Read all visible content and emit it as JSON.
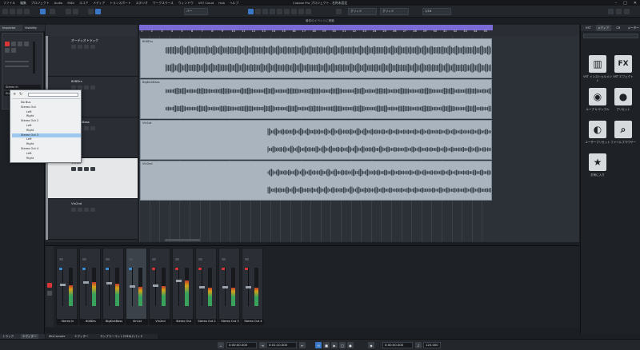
{
  "app": {
    "window_title": "Cubase Pro プロジェクト - 名称未設定",
    "menu": [
      "ファイル",
      "編集",
      "プロジェクト",
      "Audio",
      "MIDI",
      "スコア",
      "メディア",
      "トランスポート",
      "スタジオ",
      "ワークスペース",
      "ウィンドウ",
      "VST Cloud",
      "Hub",
      "ヘルプ"
    ],
    "window_controls": [
      "–",
      "□",
      "✕"
    ]
  },
  "toolbar": {
    "grid_label": "グリッド",
    "snap_label": "バー",
    "quantize_label": "1/16",
    "grid_type": "グリッド",
    "info_line": "最初のイベントに移動"
  },
  "inspector": {
    "tabs": [
      "Inspector",
      "Visibility"
    ],
    "io_labels": [
      "Stereo In",
      "Stereo Out"
    ],
    "bottom_tabs": [
      "トラック",
      "エディター"
    ]
  },
  "tracks": [
    {
      "name": "オーディオトラック",
      "color": "#8a8f96"
    },
    {
      "name": "808Drs",
      "color": "#8a8f96"
    },
    {
      "name": "BigKickBass",
      "color": "#8a8f96"
    },
    {
      "name": "Vln1st",
      "color": "#8a8f96"
    },
    {
      "name": "Vln2nd",
      "color": "#8a8f96"
    }
  ],
  "clips": [
    {
      "name": "808Drs",
      "shape": "dense"
    },
    {
      "name": "BigKickBass",
      "shape": "blocks"
    },
    {
      "name": "Vln1st",
      "shape": "late"
    },
    {
      "name": "Vln2nd",
      "shape": "late"
    }
  ],
  "ruler": {
    "bars": [
      "1",
      "2",
      "3",
      "4",
      "5",
      "6",
      "7",
      "8",
      "9",
      "10",
      "11",
      "12",
      "13",
      "14",
      "15",
      "16",
      "17",
      "18",
      "19",
      "20",
      "21",
      "22",
      "23",
      "24",
      "25",
      "26",
      "27",
      "28",
      "29",
      "30",
      "31",
      "32",
      "33",
      "34",
      "35"
    ],
    "loop_color": "#7a6ad6"
  },
  "routing_menu": {
    "items": [
      "No Bus",
      "Stereo Out",
      "Left",
      "Right",
      "Stereo Out 2",
      "Left",
      "Right",
      "Stereo Out 3",
      "Left",
      "Right",
      "Stereo Out 4",
      "Left",
      "Right"
    ],
    "highlighted_index": 7
  },
  "mixer": {
    "strips": [
      {
        "name": "Stereo In",
        "color": "#3a8fd4",
        "level": 0.55
      },
      {
        "name": "808Drs",
        "color": "#3a8fd4",
        "level": 0.62
      },
      {
        "name": "BigKickBass",
        "color": "#3a8fd4",
        "level": 0.58
      },
      {
        "name": "Vln1st",
        "color": "#3a8fd4",
        "level": 0.5
      },
      {
        "name": "Vln2nd",
        "color": "#d93535",
        "level": 0.52
      },
      {
        "name": "Stereo Out",
        "color": "#d93535",
        "level": 0.66
      },
      {
        "name": "Stereo Out 2",
        "color": "#d93535",
        "level": 0.48
      },
      {
        "name": "Stereo Out 3",
        "color": "#d93535",
        "level": 0.48
      },
      {
        "name": "Stereo Out 4",
        "color": "#d93535",
        "level": 0.48
      }
    ],
    "tabs": [
      "MixConsole",
      "エディター",
      "サンプラーコントロール",
      "コードパッド"
    ]
  },
  "rightzone": {
    "tabs": [
      "VST",
      "メディア",
      "CR",
      "メーター"
    ],
    "tiles": [
      {
        "label": "VST インストゥルメント",
        "icon": "piano-icon"
      },
      {
        "label": "VST エフェクト",
        "icon": "fx-icon"
      },
      {
        "label": "ループ & サンプル",
        "icon": "loop-icon"
      },
      {
        "label": "プリセット",
        "icon": "preset-icon"
      },
      {
        "label": "ユーザープリセット",
        "icon": "user-preset-icon"
      },
      {
        "label": "ファイルブラウザー",
        "icon": "file-browser-icon"
      },
      {
        "label": "お気に入り",
        "icon": "star-icon"
      }
    ]
  },
  "transport": {
    "left_time": "0:00:00.000",
    "mid_time": "0:01:10.000",
    "pos_time": "0:00:00.000",
    "tempo": "120.000"
  }
}
